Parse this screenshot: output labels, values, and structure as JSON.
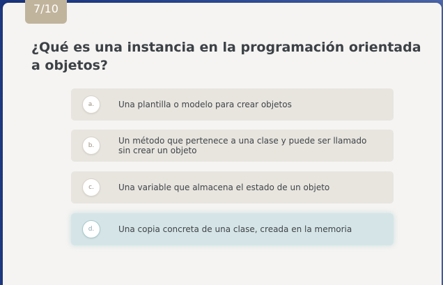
{
  "quiz": {
    "counter": "7/10",
    "question": "¿Qué es una instancia en la programación orientada a objetos?",
    "options": [
      {
        "letter": "a.",
        "text": "Una plantilla o modelo para crear objetos"
      },
      {
        "letter": "b.",
        "text": "Un método que pertenece a una clase y puede ser llamado sin crear un objeto"
      },
      {
        "letter": "c.",
        "text": "Una variable que almacena el estado de un objeto"
      },
      {
        "letter": "d.",
        "text": "Una copia concreta de una clase, creada en la memoria"
      }
    ],
    "selected_option": "d."
  },
  "colors": {
    "card_background": "#f5f4f2",
    "option_background": "#e8e5df",
    "selected_background": "#d5e5e7",
    "badge": "#c1b49c",
    "question_text": "#3c4146"
  }
}
